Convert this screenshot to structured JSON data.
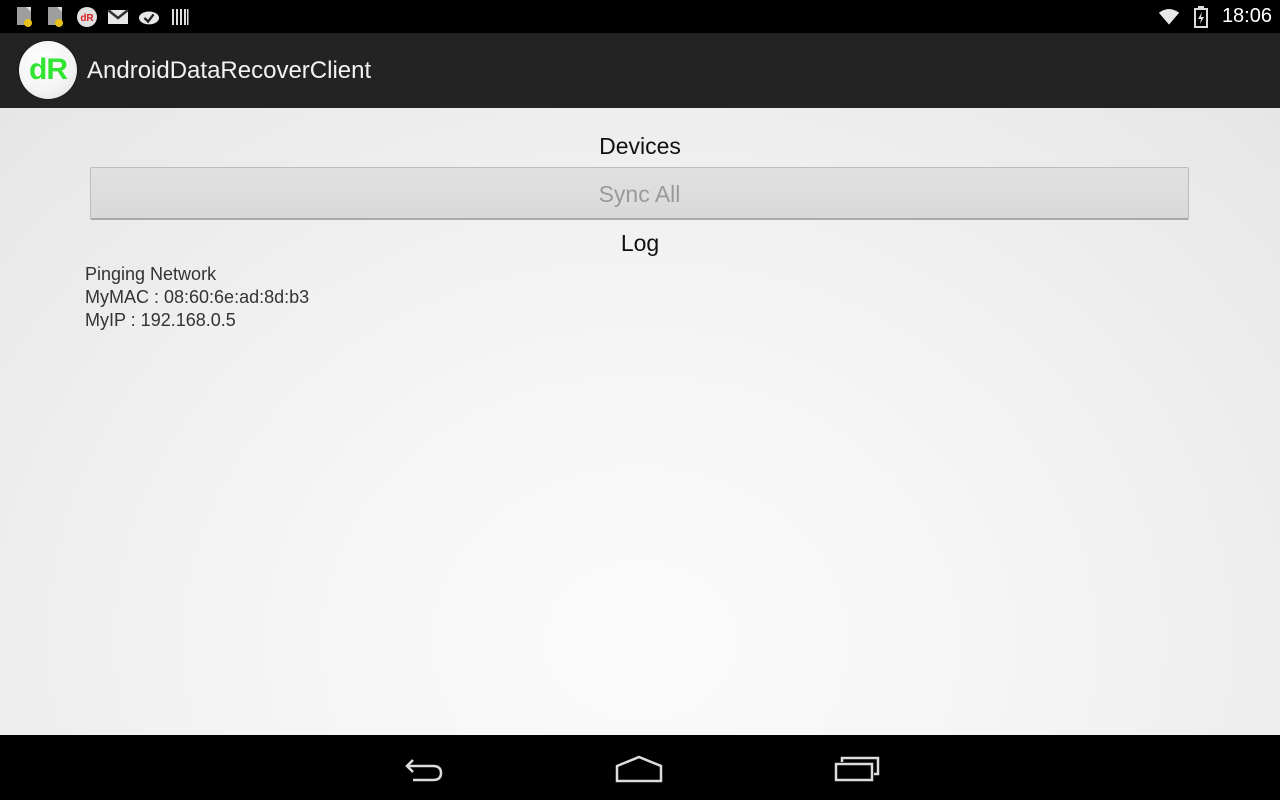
{
  "status_bar": {
    "icons": [
      "notification-file-icon",
      "notification-file-icon",
      "dr-app-notification-icon",
      "gmail-icon",
      "sync-done-icon",
      "barcode-icon",
      "wifi-icon",
      "battery-icon"
    ],
    "time": "18:06"
  },
  "action_bar": {
    "logo_text": "dR",
    "logo_color": "#33e533",
    "title": "AndroidDataRecoverClient"
  },
  "main": {
    "devices_heading": "Devices",
    "sync_button_label": "Sync All",
    "log_heading": "Log",
    "log_lines": [
      "Pinging Network",
      "MyMAC : 08:60:6e:ad:8d:b3",
      "MyIP : 192.168.0.5"
    ]
  },
  "nav_bar": {
    "buttons": [
      "back-icon",
      "home-icon",
      "recents-icon"
    ]
  }
}
